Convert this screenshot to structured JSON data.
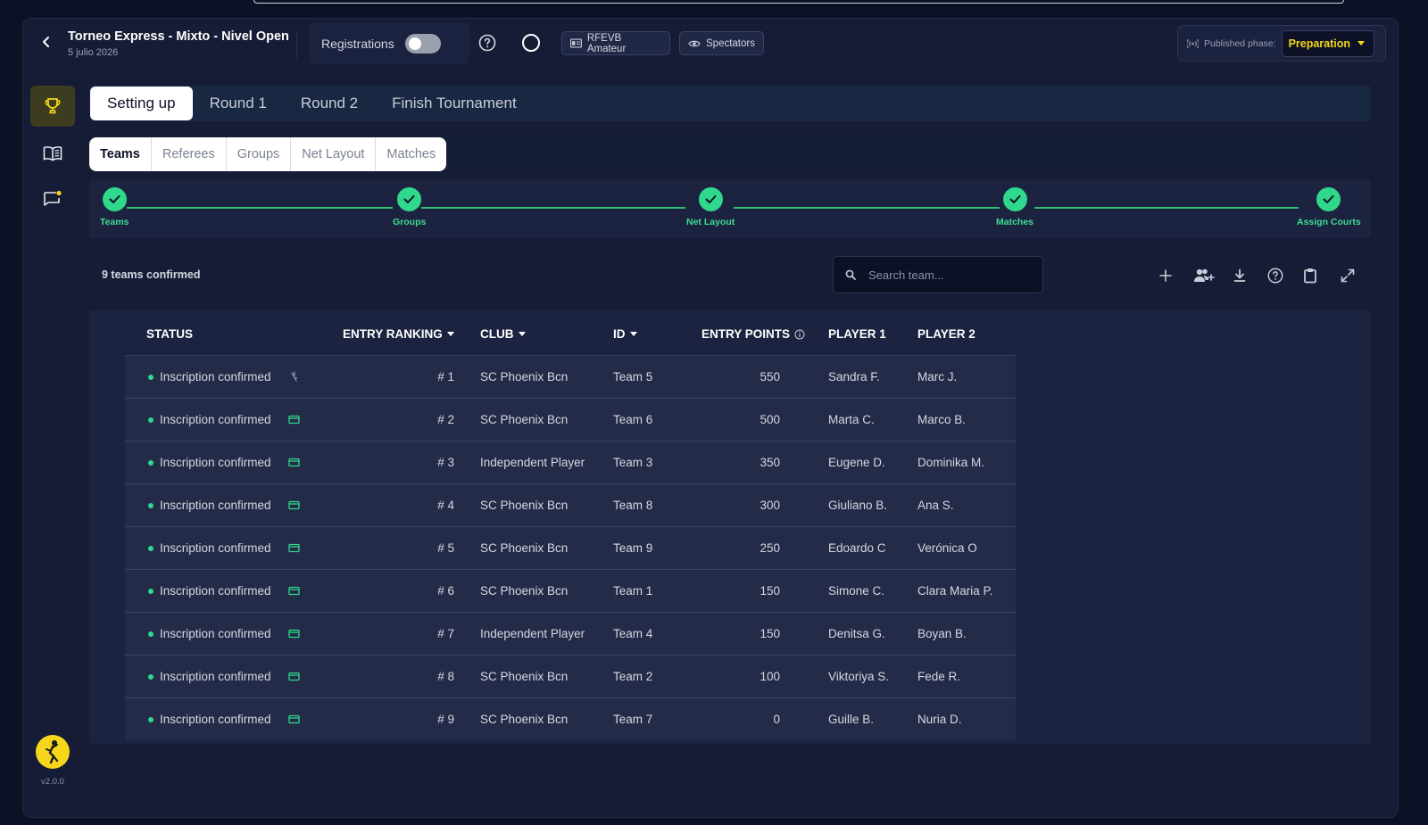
{
  "header": {
    "title": "Torneo Express - Mixto - Nivel Open",
    "date": "5 julio 2026",
    "registrations_label": "Registrations",
    "chip_federation": "RFEVB Amateur",
    "chip_spectators": "Spectators",
    "published_phase_label": "Published phase:",
    "published_phase_value": "Preparation"
  },
  "main_tabs": [
    "Setting up",
    "Round 1",
    "Round 2",
    "Finish Tournament"
  ],
  "sub_tabs": [
    "Teams",
    "Referees",
    "Groups",
    "Net Layout",
    "Matches"
  ],
  "stepper": [
    "Teams",
    "Groups",
    "Net Layout",
    "Matches",
    "Assign Courts"
  ],
  "toolbar": {
    "count_text": "9 teams confirmed",
    "search_placeholder": "Search team..."
  },
  "table": {
    "headers": [
      "STATUS",
      "ENTRY RANKING",
      "CLUB",
      "ID",
      "ENTRY POINTS",
      "PLAYER 1",
      "PLAYER 2"
    ],
    "rows": [
      {
        "status": "Inscription confirmed",
        "rank": "# 1",
        "club": "SC Phoenix Bcn",
        "id": "Team 5",
        "points": "550",
        "p1": "Sandra F.",
        "p2": "Marc J."
      },
      {
        "status": "Inscription confirmed",
        "rank": "# 2",
        "club": "SC Phoenix Bcn",
        "id": "Team 6",
        "points": "500",
        "p1": "Marta C.",
        "p2": "Marco B."
      },
      {
        "status": "Inscription confirmed",
        "rank": "# 3",
        "club": "Independent Player",
        "id": "Team 3",
        "points": "350",
        "p1": "Eugene D.",
        "p2": "Dominika M."
      },
      {
        "status": "Inscription confirmed",
        "rank": "# 4",
        "club": "SC Phoenix Bcn",
        "id": "Team 8",
        "points": "300",
        "p1": "Giuliano B.",
        "p2": "Ana S."
      },
      {
        "status": "Inscription confirmed",
        "rank": "# 5",
        "club": "SC Phoenix Bcn",
        "id": "Team 9",
        "points": "250",
        "p1": "Edoardo  C",
        "p2": "Verónica  O"
      },
      {
        "status": "Inscription confirmed",
        "rank": "# 6",
        "club": "SC Phoenix Bcn",
        "id": "Team 1",
        "points": "150",
        "p1": "Simone C.",
        "p2": "Clara Maria P."
      },
      {
        "status": "Inscription confirmed",
        "rank": "# 7",
        "club": "Independent Player",
        "id": "Team 4",
        "points": "150",
        "p1": "Denitsa G.",
        "p2": "Boyan B."
      },
      {
        "status": "Inscription confirmed",
        "rank": "# 8",
        "club": "SC Phoenix Bcn",
        "id": "Team 2",
        "points": "100",
        "p1": "Viktoriya S.",
        "p2": "Fede R."
      },
      {
        "status": "Inscription confirmed",
        "rank": "# 9",
        "club": "SC Phoenix Bcn",
        "id": "Team 7",
        "points": "0",
        "p1": "Guille B.",
        "p2": "Nuria D."
      }
    ]
  },
  "sidebar": {
    "version": "v2.0.0"
  },
  "colors": {
    "accent_yellow": "#f5d61b",
    "success_green": "#2fd88a",
    "background": "#0d1126"
  },
  "icons": {
    "back": "chevron-left-icon",
    "help": "help-circle-icon",
    "federation": "id-card-icon",
    "spectators": "eye-icon",
    "broadcast": "broadcast-icon",
    "trophy": "trophy-icon",
    "book": "book-icon",
    "chat": "chat-icon",
    "add": "plus-icon",
    "add_team": "add-team-icon",
    "download": "download-icon",
    "clipboard": "clipboard-icon",
    "expand": "expand-icon",
    "search": "search-icon"
  }
}
